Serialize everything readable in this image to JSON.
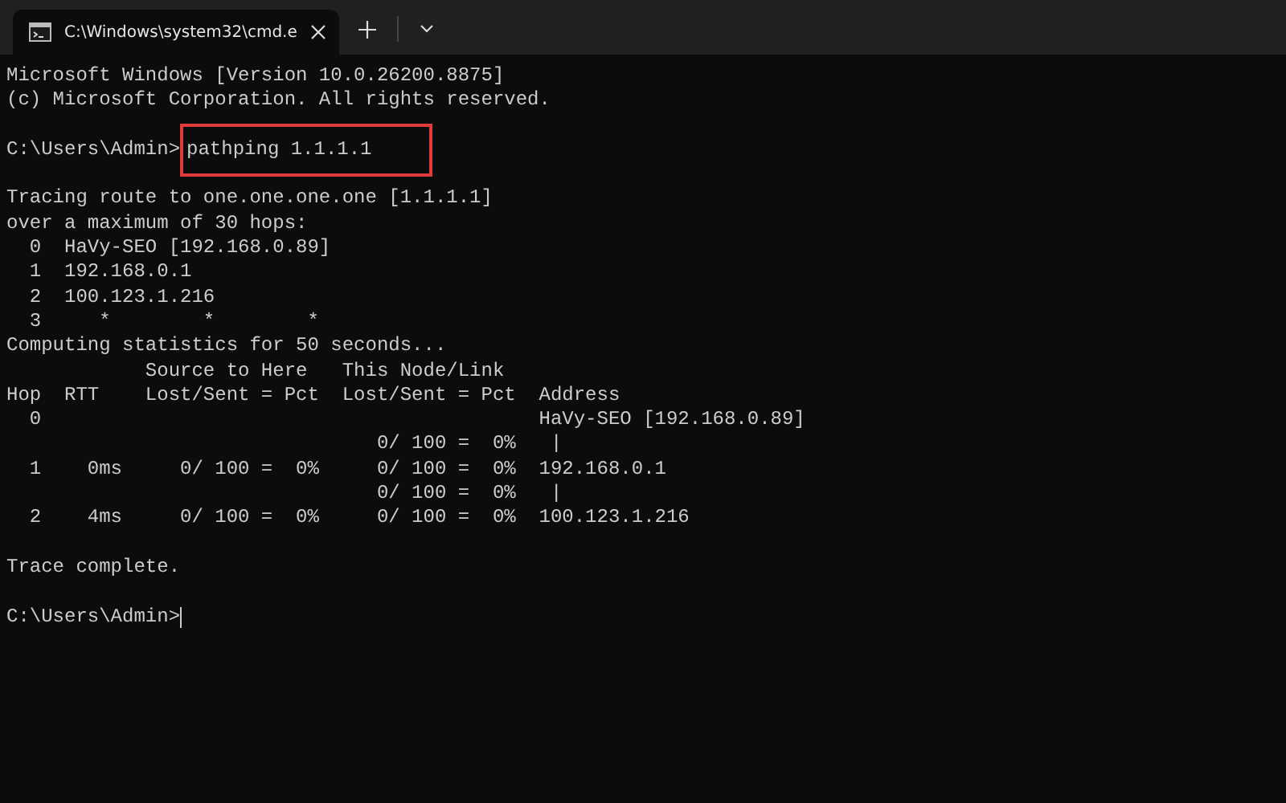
{
  "tab": {
    "title": "C:\\Windows\\system32\\cmd.e",
    "selected": true
  },
  "lines": [
    {
      "kind": "text",
      "text": "Microsoft Windows [Version 10.0.26200.8875]"
    },
    {
      "kind": "text",
      "text": "(c) Microsoft Corporation. All rights reserved."
    },
    {
      "kind": "blank"
    },
    {
      "kind": "prompt",
      "prompt": "C:\\Users\\Admin>",
      "command": "pathping 1.1.1.1",
      "highlighted": true
    },
    {
      "kind": "blank"
    },
    {
      "kind": "text",
      "text": "Tracing route to one.one.one.one [1.1.1.1]"
    },
    {
      "kind": "text",
      "text": "over a maximum of 30 hops:"
    },
    {
      "kind": "text",
      "text": "  0  HaVy-SEO [192.168.0.89]"
    },
    {
      "kind": "text",
      "text": "  1  192.168.0.1"
    },
    {
      "kind": "text",
      "text": "  2  100.123.1.216"
    },
    {
      "kind": "text",
      "text": "  3     *        *        *"
    },
    {
      "kind": "text",
      "text": "Computing statistics for 50 seconds..."
    },
    {
      "kind": "text",
      "text": "            Source to Here   This Node/Link"
    },
    {
      "kind": "text",
      "text": "Hop  RTT    Lost/Sent = Pct  Lost/Sent = Pct  Address"
    },
    {
      "kind": "text",
      "text": "  0                                           HaVy-SEO [192.168.0.89]"
    },
    {
      "kind": "text",
      "text": "                                0/ 100 =  0%   |"
    },
    {
      "kind": "text",
      "text": "  1    0ms     0/ 100 =  0%     0/ 100 =  0%  192.168.0.1"
    },
    {
      "kind": "text",
      "text": "                                0/ 100 =  0%   |"
    },
    {
      "kind": "text",
      "text": "  2    4ms     0/ 100 =  0%     0/ 100 =  0%  100.123.1.216"
    },
    {
      "kind": "blank"
    },
    {
      "kind": "text",
      "text": "Trace complete."
    },
    {
      "kind": "blank"
    },
    {
      "kind": "input",
      "prompt": "C:\\Users\\Admin>"
    }
  ]
}
